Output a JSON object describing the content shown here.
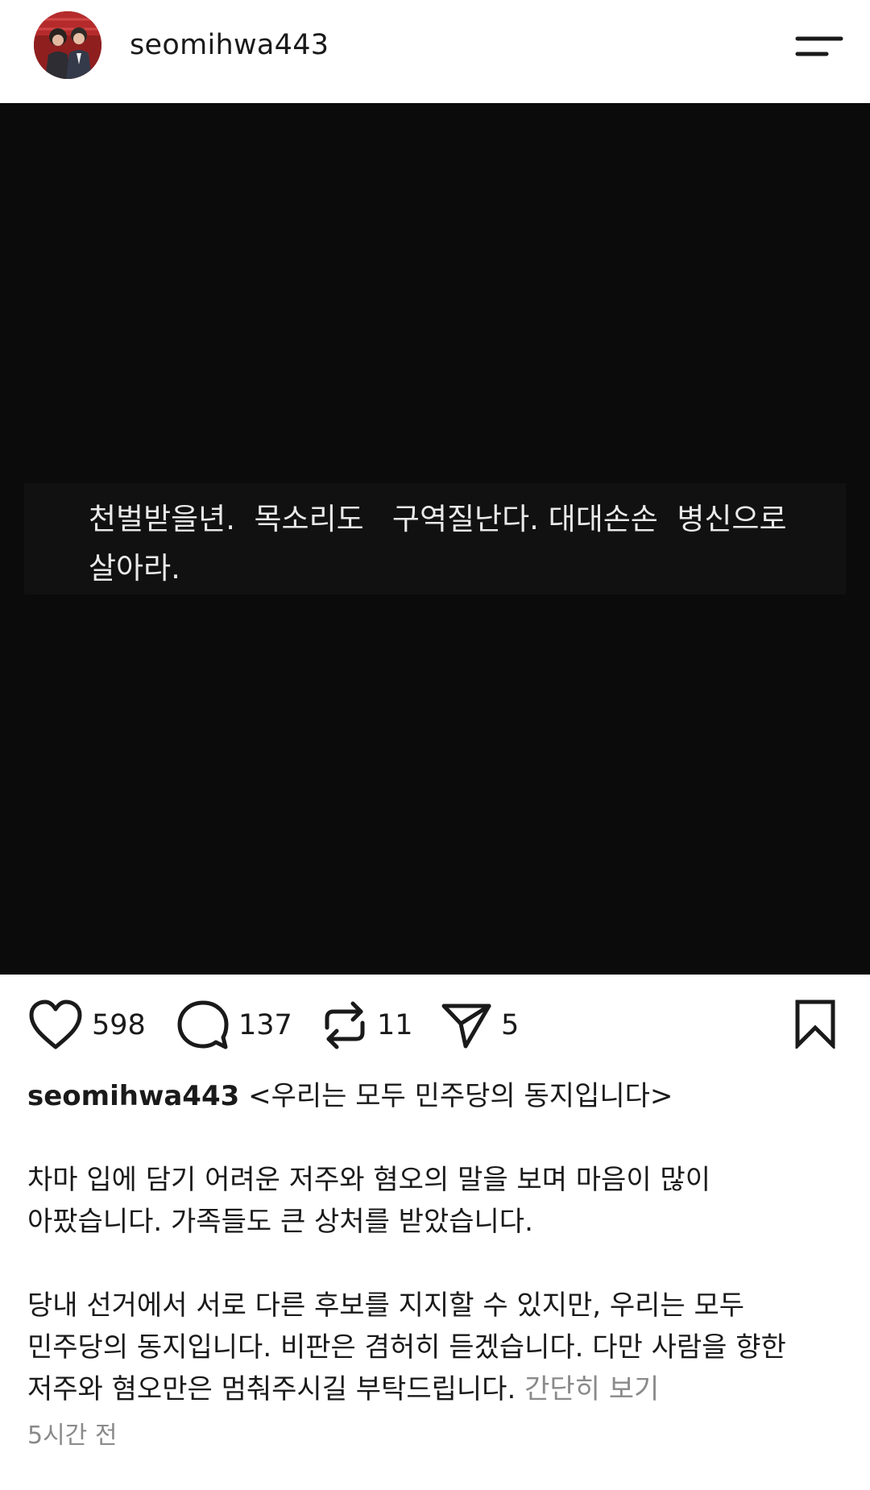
{
  "header": {
    "username": "seomihwa443"
  },
  "media": {
    "caption_lines": [
      "천벌받을년.  목소리도   구역질난다. 대대손손  병신으로",
      "살아라."
    ],
    "background_color": "#0b0b0b"
  },
  "actions": {
    "likes": "598",
    "comments": "137",
    "reposts": "11",
    "shares": "5"
  },
  "post": {
    "author": "seomihwa443",
    "title": "<우리는 모두 민주당의 동지입니다>",
    "paragraph1_line1": "차마 입에 담기 어려운 저주와 혐오의 말을 보며 마음이 많이",
    "paragraph1_line2": "아팠습니다. 가족들도 큰 상처를 받았습니다.",
    "paragraph2_line1": "당내 선거에서 서로 다른 후보를 지지할 수 있지만, 우리는 모두",
    "paragraph2_line2": "민주당의 동지입니다. 비판은 겸허히 듣겠습니다. 다만 사람을 향한",
    "paragraph2_line3": "저주와 혐오만은 멈춰주시길 부탁드립니다.",
    "see_less": "간단히 보기",
    "timestamp": "5시간 전"
  },
  "icons": {
    "menu": "menu-icon",
    "like": "heart-icon",
    "comment": "comment-bubble-icon",
    "repost": "repost-icon",
    "share": "send-icon",
    "bookmark": "bookmark-icon"
  }
}
